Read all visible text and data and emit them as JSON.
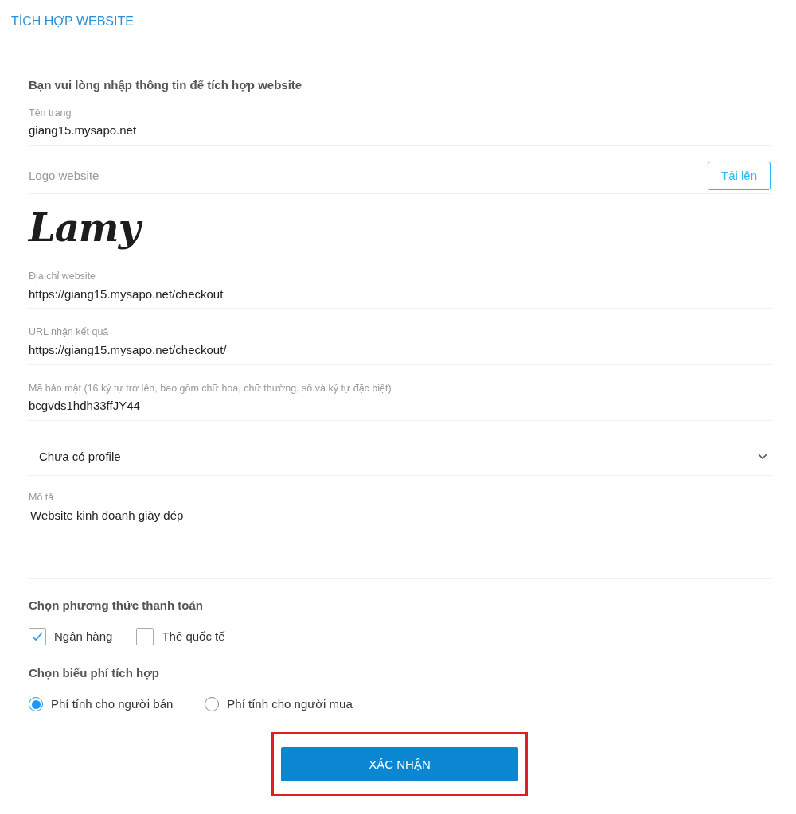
{
  "page_title": "TÍCH HỢP WEBSITE",
  "intro": "Bạn vui lòng nhập thông tin để tích hợp website",
  "site_name": {
    "label": "Tên trang",
    "value": "giang15.mysapo.net"
  },
  "logo": {
    "label": "Logo website",
    "upload_button": "Tải lên",
    "logo_text": "Lamy"
  },
  "fields": [
    {
      "label": "Địa chỉ website",
      "value": "https://giang15.mysapo.net/checkout"
    },
    {
      "label": "URL nhận kết quả",
      "value": "https://giang15.mysapo.net/checkout/"
    },
    {
      "label": "Mã bảo mật (16 ký tự trở lên, bao gồm chữ hoa, chữ thường, số và ký tự đặc biệt)",
      "value": "bcgvds1hdh33ffJY44"
    }
  ],
  "profile_select": {
    "value": "Chưa có profile"
  },
  "description": {
    "label": "Mô tả",
    "value": "Website kinh doanh giày dép"
  },
  "payment": {
    "heading": "Chọn phương thức thanh toán",
    "options": [
      {
        "label": "Ngân hàng",
        "checked": true
      },
      {
        "label": "Thẻ quốc tế",
        "checked": false
      }
    ]
  },
  "fee": {
    "heading": "Chọn biểu phí tích hợp",
    "options": [
      {
        "label": "Phí tính cho người bán",
        "selected": true
      },
      {
        "label": "Phí tính cho người mua",
        "selected": false
      }
    ]
  },
  "confirm_button": {
    "label": "XÁC NHẬN",
    "highlighted": true
  }
}
